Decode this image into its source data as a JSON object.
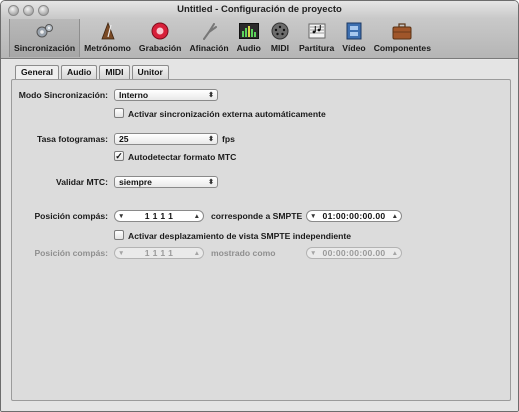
{
  "window": {
    "title": "Untitled - Configuración de proyecto"
  },
  "toolbar": {
    "items": [
      {
        "label": "Sincronización",
        "icon": "gears-icon"
      },
      {
        "label": "Metrónomo",
        "icon": "metronome-icon"
      },
      {
        "label": "Grabación",
        "icon": "record-icon"
      },
      {
        "label": "Afinación",
        "icon": "tuning-fork-icon"
      },
      {
        "label": "Audio",
        "icon": "audio-meter-icon"
      },
      {
        "label": "MIDI",
        "icon": "midi-port-icon"
      },
      {
        "label": "Partitura",
        "icon": "score-icon"
      },
      {
        "label": "Vídeo",
        "icon": "film-icon"
      },
      {
        "label": "Componentes",
        "icon": "briefcase-icon"
      }
    ]
  },
  "tabs": [
    "General",
    "Audio",
    "MIDI",
    "Unitor"
  ],
  "form": {
    "modo_label": "Modo Sincronización:",
    "modo_value": "Interno",
    "sync_ext_label": "Activar sincronización externa automáticamente",
    "tasa_label": "Tasa fotogramas:",
    "tasa_value": "25",
    "tasa_unit": "fps",
    "autodetect_label": "Autodetectar formato MTC",
    "autodetect_mark": "✓",
    "validar_label": "Validar MTC:",
    "validar_value": "siempre",
    "pos1_label": "Posición compás:",
    "pos1_value": "1   1   1   1",
    "corresponde_label": "corresponde a SMPTE",
    "smpte1_value": "01:00:00:00.00",
    "desplaz_label": "Activar desplazamiento de vista SMPTE independiente",
    "pos2_label": "Posición compás:",
    "pos2_value": "1   1   1   1",
    "mostrado_label": "mostrado como",
    "smpte2_value": "00:00:00:00.00"
  },
  "colors": {
    "record_red": "#d8203a",
    "window_bg": "#e4e4e4"
  }
}
